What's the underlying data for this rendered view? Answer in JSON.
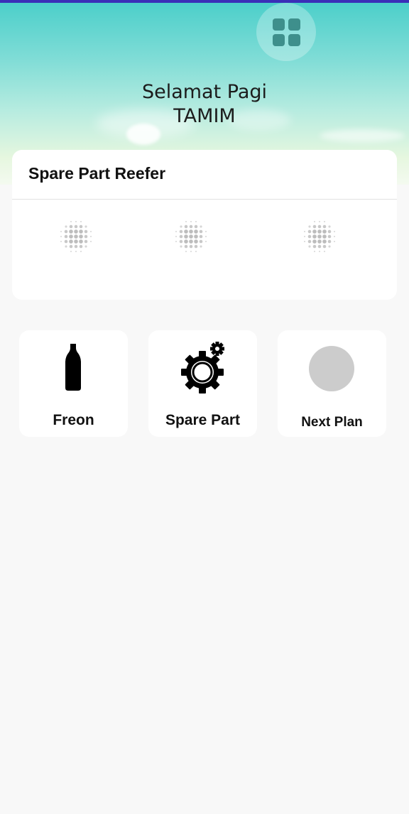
{
  "header": {
    "greeting": "Selamat Pagi",
    "username": "TAMIM",
    "menu_icon": "grid-menu-icon"
  },
  "spare_part_card": {
    "title": "Spare Part Reefer",
    "loading_indicators": 3
  },
  "tiles": [
    {
      "label": "Freon",
      "icon": "bottle-icon"
    },
    {
      "label": "Spare Part",
      "icon": "gear-icon"
    },
    {
      "label": "Next Plan",
      "icon": "circle-placeholder-icon"
    }
  ],
  "colors": {
    "top_bar": "#3a2fb8",
    "sky_top": "#4ccfca",
    "menu_squares": "#3e8f8c",
    "background": "#f8f8f8"
  }
}
